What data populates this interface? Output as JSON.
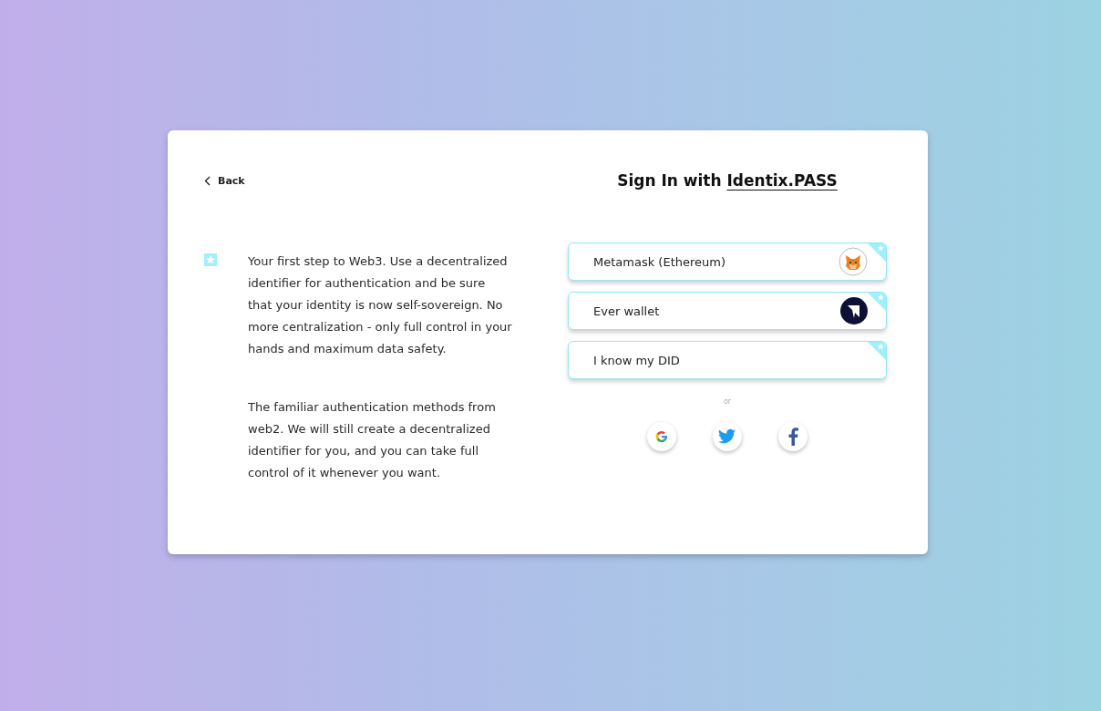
{
  "back": {
    "label": "Back"
  },
  "intro": {
    "paragraphs": [
      "Your first step to Web3. Use a decentralized identifier for authentication and be sure that your identity is now self-sovereign. No more centralization - only full control in your hands and maximum data safety.",
      "The familiar authentication methods from web2. We will still create a decentralized identifier for you, and you can take full control of it whenever you want."
    ]
  },
  "title": {
    "prefix": "Sign In with",
    "link": "Identix.PASS"
  },
  "options": [
    {
      "label": "Metamask (Ethereum)",
      "kind": "fox"
    },
    {
      "label": "Ever wallet",
      "kind": "ever"
    },
    {
      "label": "I know my DID",
      "kind": "plain"
    }
  ],
  "divider": "or",
  "social": [
    {
      "kind": "google"
    },
    {
      "kind": "twitter"
    },
    {
      "kind": "facebook"
    }
  ]
}
